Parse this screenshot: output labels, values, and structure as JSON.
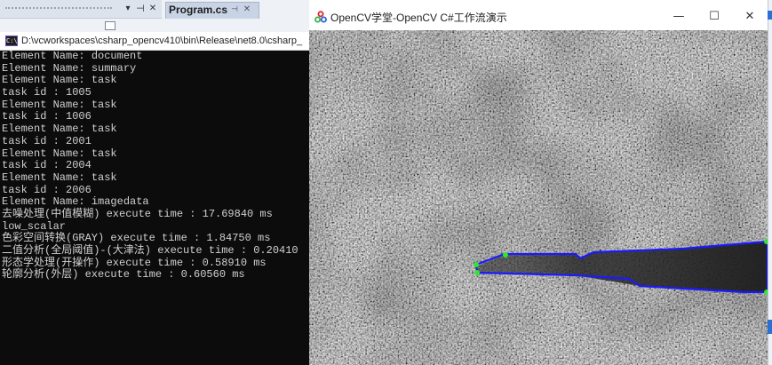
{
  "ide": {
    "tab_label": "Program.cs",
    "pin_glyph": "▾",
    "tab_pin_glyph": "⊣",
    "close_glyph": "✕"
  },
  "console": {
    "icon_text": "C:\\",
    "path": "D:\\vcworkspaces\\csharp_opencv410\\bin\\Release\\net8.0\\csharp_",
    "lines": [
      "Element Name: document",
      "Element Name: summary",
      "Element Name: task",
      "task id : 1005",
      "Element Name: task",
      "task id : 1006",
      "Element Name: task",
      "task id : 2001",
      "Element Name: task",
      "task id : 2004",
      "Element Name: task",
      "task id : 2006",
      "Element Name: imagedata",
      "去噪处理(中值模糊) execute time : 17.69840 ms",
      "low_scalar",
      "色彩空间转换(GRAY) execute time : 1.84750 ms",
      "二值分析(全局阈值)-(大津法) execute time : 0.20410",
      "形态学处理(开操作) execute time : 0.58910 ms",
      "轮廓分析(外层) execute time : 0.60560 ms"
    ]
  },
  "cv_window": {
    "title": "OpenCV学堂-OpenCV C#工作流演示",
    "minimize_glyph": "—",
    "maximize_glyph": "☐",
    "close_glyph": "✕"
  },
  "colors": {
    "contour": "#1a1aff",
    "points": "#2ee82e",
    "console_bg": "#0c0c0c",
    "console_text": "#d0d0d0"
  }
}
